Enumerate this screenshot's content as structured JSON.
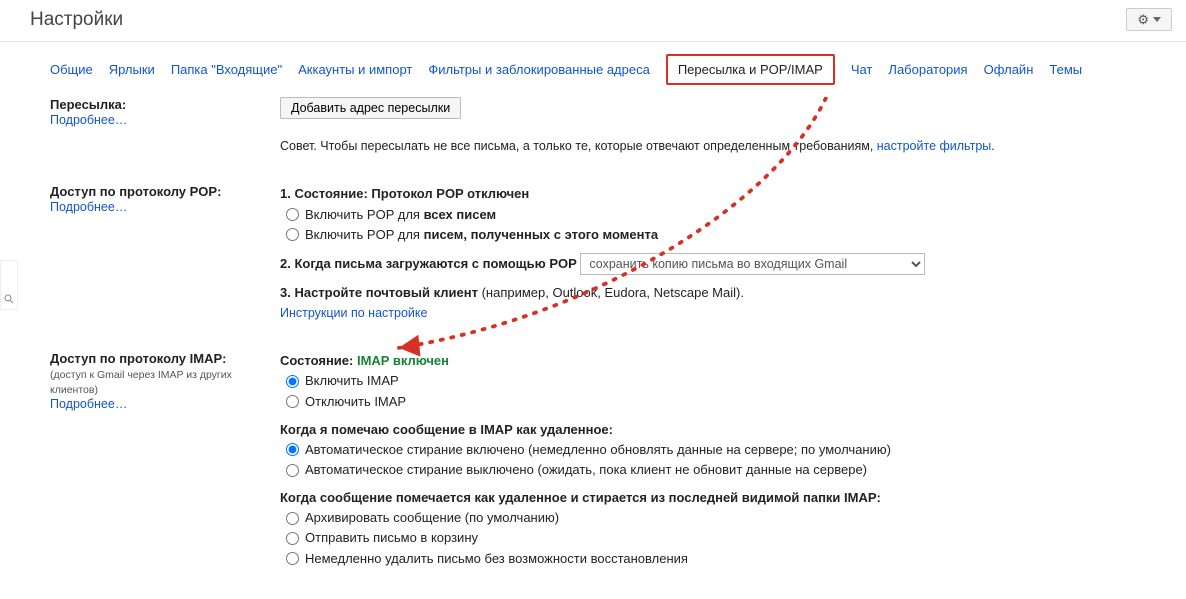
{
  "header": {
    "title": "Настройки"
  },
  "tabs": {
    "general": "Общие",
    "labels": "Ярлыки",
    "inbox": "Папка \"Входящие\"",
    "accounts": "Аккаунты и импорт",
    "filters": "Фильтры и заблокированные адреса",
    "fwd_pop_imap": "Пересылка и POP/IMAP",
    "chat": "Чат",
    "labs": "Лаборатория",
    "offline": "Офлайн",
    "themes": "Темы"
  },
  "forwarding": {
    "title": "Пересылка:",
    "learn": "Подробнее…",
    "add_btn": "Добавить адрес пересылки",
    "tip_pre": "Совет. Чтобы пересылать не все письма, а только те, которые отвечают определенным требованиям, ",
    "tip_link": "настройте фильтры",
    "tip_post": "."
  },
  "pop": {
    "title": "Доступ по протоколу POP:",
    "learn": "Подробнее…",
    "l1_pre": "1. Состояние: ",
    "l1_status": "Протокол POP отключен",
    "r1": "Включить POP для ",
    "r1b": "всех писем",
    "r2": "Включить POP для ",
    "r2b": "писем, полученных с этого момента",
    "l2": "2. Когда письма загружаются с помощью POP",
    "select_value": "сохранить копию письма во входящих Gmail",
    "l3_pre": "3. Настройте почтовый клиент ",
    "l3_post": "(например, Outlook, Eudora, Netscape Mail).",
    "instr": "Инструкции по настройке"
  },
  "imap": {
    "title": "Доступ по протоколу IMAP:",
    "sub": "(доступ к Gmail через IMAP из других клиентов)",
    "learn": "Подробнее…",
    "status_pre": "Состояние: ",
    "status_val": "IMAP включен",
    "r_on": "Включить IMAP",
    "r_off": "Отключить IMAP",
    "expunge_q": "Когда я помечаю сообщение в IMAP как удаленное:",
    "exp_on": "Автоматическое стирание включено (немедленно обновлять данные на сервере; по умолчанию)",
    "exp_off": "Автоматическое стирание выключено (ожидать, пока клиент не обновит данные на сервере)",
    "last_q": "Когда сообщение помечается как удаленное и стирается из последней видимой папки IMAP:",
    "last_a": "Архивировать сообщение (по умолчанию)",
    "last_b": "Отправить письмо в корзину",
    "last_c": "Немедленно удалить письмо без возможности восстановления"
  }
}
